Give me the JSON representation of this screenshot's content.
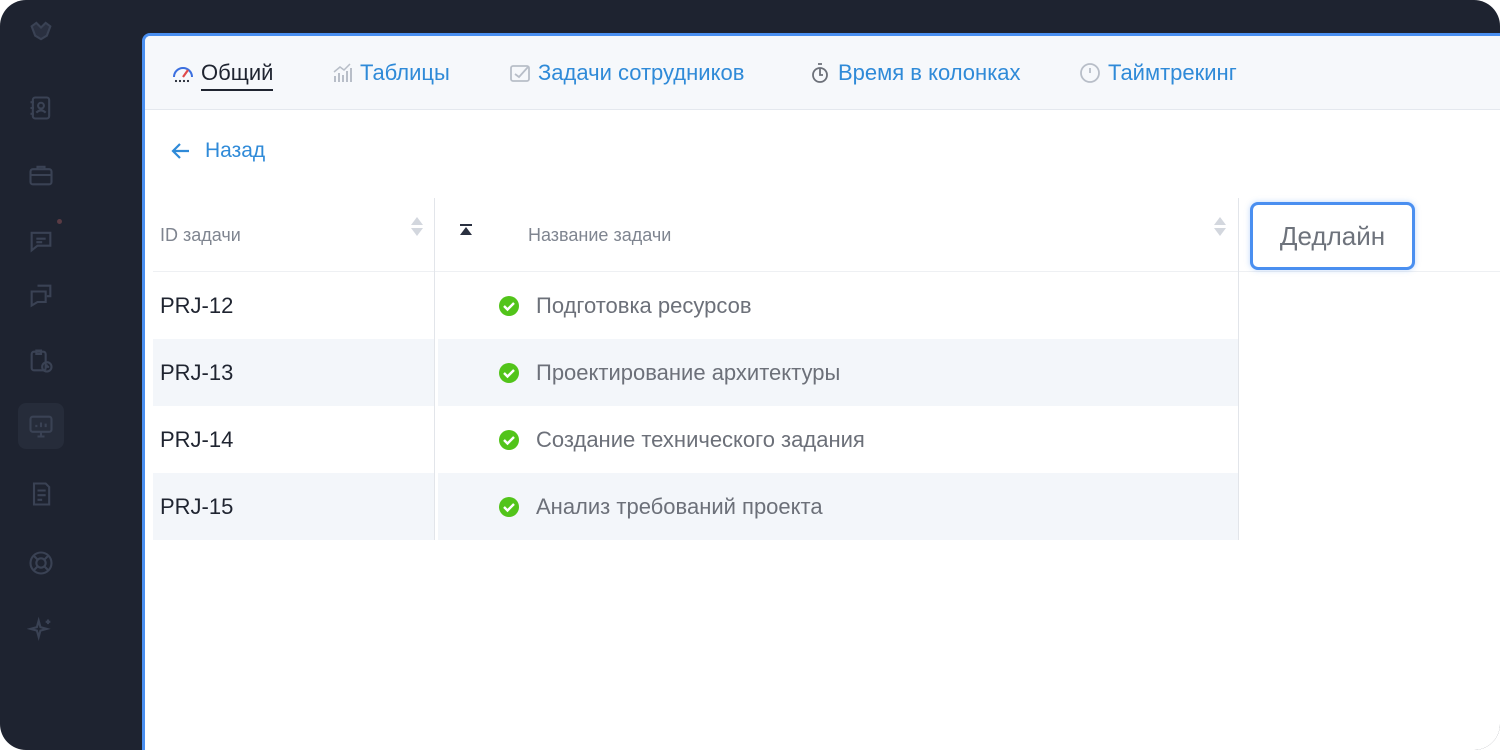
{
  "sidebar": {
    "items": [
      {
        "icon": "logo-icon"
      },
      {
        "icon": "contacts-book-icon"
      },
      {
        "icon": "briefcase-icon"
      },
      {
        "icon": "chat-icon"
      },
      {
        "icon": "messages-icon"
      },
      {
        "icon": "clipboard-clock-icon"
      },
      {
        "icon": "monitor-chart-icon",
        "active": true
      },
      {
        "icon": "document-icon"
      },
      {
        "icon": "lifebuoy-icon"
      },
      {
        "icon": "sparkles-icon"
      }
    ]
  },
  "tabs": [
    {
      "label": "Общий",
      "icon": "speedometer-icon",
      "active": true
    },
    {
      "label": "Таблицы",
      "icon": "bar-chart-icon"
    },
    {
      "label": "Задачи сотрудников",
      "icon": "task-check-icon"
    },
    {
      "label": "Время в колонках",
      "icon": "stopwatch-icon"
    },
    {
      "label": "Таймтрекинг",
      "icon": "clock-icon"
    }
  ],
  "back": {
    "label": "Назад"
  },
  "table": {
    "columns": {
      "id": "ID задачи",
      "name": "Название задачи",
      "deadline": "Дедлайн"
    },
    "rows": [
      {
        "id": "PRJ-12",
        "name": "Подготовка ресурсов",
        "status": "done"
      },
      {
        "id": "PRJ-13",
        "name": "Проектирование архитектуры",
        "status": "done"
      },
      {
        "id": "PRJ-14",
        "name": "Создание технического задания",
        "status": "done"
      },
      {
        "id": "PRJ-15",
        "name": "Анализ требований проекта",
        "status": "done"
      }
    ]
  },
  "colors": {
    "accent": "#4a8ff0",
    "link": "#2f8ad8",
    "success": "#52c41a",
    "sidebar_bg": "#1e2330"
  }
}
